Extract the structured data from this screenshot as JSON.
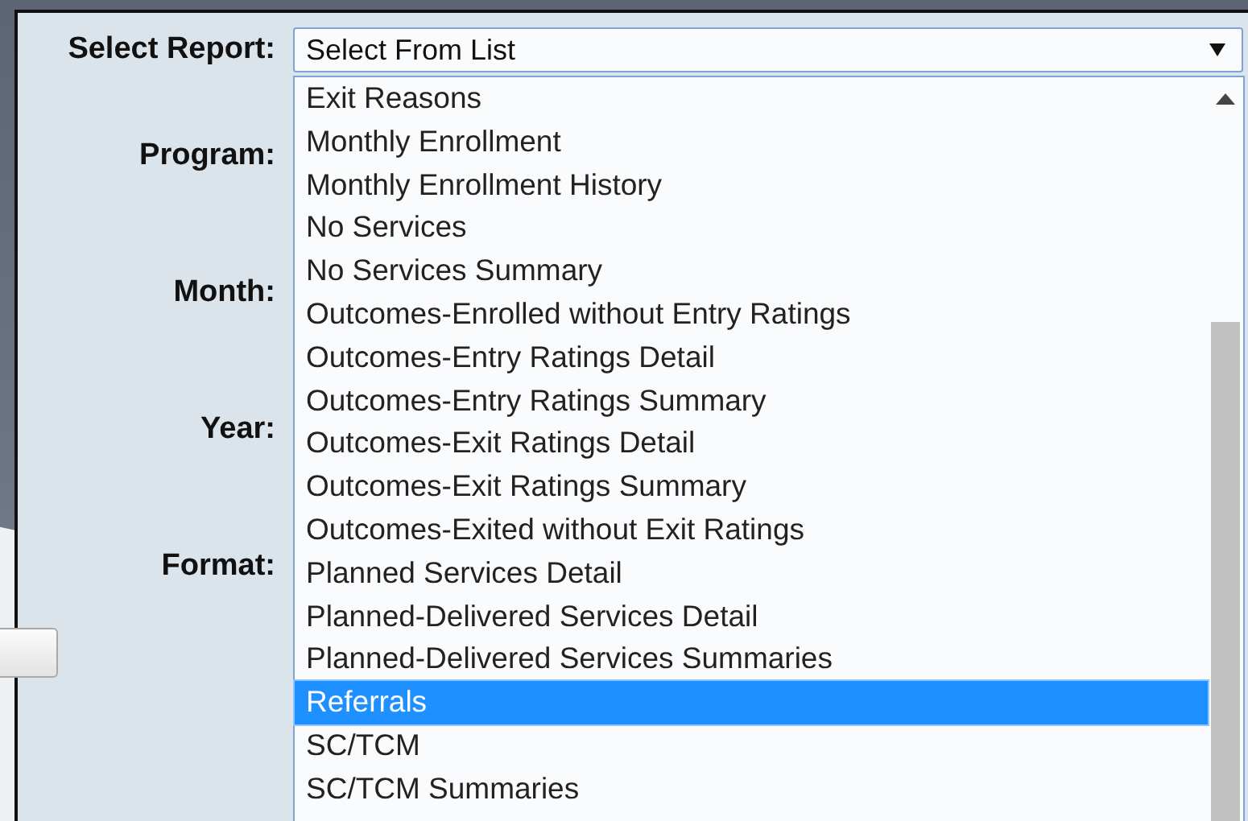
{
  "form": {
    "fields": [
      {
        "label": "Select Report:",
        "kind": "select"
      },
      {
        "label": "Program:",
        "kind": "blank"
      },
      {
        "label": "Month:",
        "kind": "blank"
      },
      {
        "label": "Year:",
        "kind": "blank"
      },
      {
        "label": "Format:",
        "kind": "blank"
      }
    ]
  },
  "report_select": {
    "value": "Select From List",
    "expanded": true,
    "options": [
      {
        "label": "Exit Reasons",
        "selected": false
      },
      {
        "label": "Monthly Enrollment",
        "selected": false
      },
      {
        "label": "Monthly Enrollment History",
        "selected": false
      },
      {
        "label": "No Services",
        "selected": false
      },
      {
        "label": "No Services Summary",
        "selected": false
      },
      {
        "label": "Outcomes-Enrolled without Entry Ratings",
        "selected": false
      },
      {
        "label": "Outcomes-Entry Ratings Detail",
        "selected": false
      },
      {
        "label": "Outcomes-Entry Ratings Summary",
        "selected": false
      },
      {
        "label": "Outcomes-Exit Ratings Detail",
        "selected": false
      },
      {
        "label": "Outcomes-Exit Ratings Summary",
        "selected": false
      },
      {
        "label": "Outcomes-Exited without Exit Ratings",
        "selected": false
      },
      {
        "label": "Planned Services Detail",
        "selected": false
      },
      {
        "label": "Planned-Delivered Services Detail",
        "selected": false
      },
      {
        "label": "Planned-Delivered Services Summaries",
        "selected": false
      },
      {
        "label": "Referrals",
        "selected": true
      },
      {
        "label": "SC/TCM",
        "selected": false
      },
      {
        "label": "SC/TCM Summaries",
        "selected": false
      }
    ]
  }
}
